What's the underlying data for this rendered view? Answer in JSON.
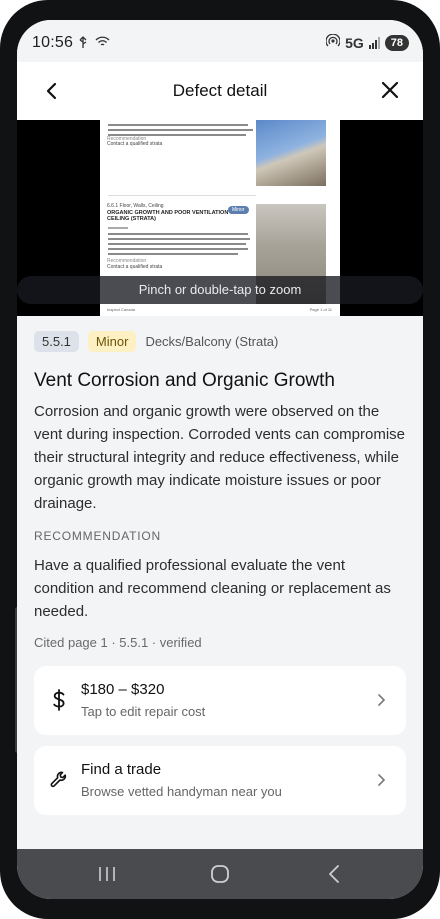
{
  "status_bar": {
    "time": "10:56",
    "network": "5G",
    "battery": "78",
    "left_icons": [
      "usb-icon",
      "wifi-icon"
    ],
    "right_icons": [
      "hotspot-icon",
      "signal-icon"
    ]
  },
  "header": {
    "title": "Defect detail",
    "back_icon": "chevron-left-icon",
    "close_icon": "close-icon"
  },
  "preview": {
    "zoom_hint": "Pinch or double-tap to zoom",
    "page_lines": {
      "rec1": "Recommendation",
      "contact1": "Contact a qualified strata",
      "section": "6.6.1 Floor, Walls, Ceiling",
      "heading1": "ORGANIC GROWTH AND POOR VENTILATION ON",
      "heading2": "CEILING (STRATA)",
      "severity": "Minor",
      "rec2": "Recommendation",
      "contact2": "Contact a qualified strata",
      "footer_left": "Inspect Canada",
      "footer_right": "Page 1 of 11"
    }
  },
  "defect": {
    "number": "5.5.1",
    "severity": "Minor",
    "location": "Decks/Balcony (Strata)",
    "title": "Vent Corrosion and Organic Growth",
    "description": "Corrosion and organic growth were observed on the vent during inspection. Corroded vents can compromise their structural integrity and reduce effectiveness, while organic growth may indicate moisture issues or poor drainage.",
    "recommendation_label": "RECOMMENDATION",
    "recommendation": "Have a qualified professional evaluate the vent condition and recommend cleaning or replacement as needed.",
    "cited": "Cited page 1 · 5.5.1 · verified"
  },
  "cards": {
    "cost": {
      "title": "$180 – $320",
      "subtitle": "Tap to edit repair cost",
      "icon": "dollar-icon"
    },
    "trade": {
      "title": "Find a trade",
      "subtitle": "Browse vetted handyman near you",
      "icon": "wrench-icon"
    }
  },
  "nav": {
    "recents_icon": "recents-icon",
    "home_icon": "home-icon",
    "back_icon": "back-icon"
  },
  "colors": {
    "background": "#f3f4f6",
    "severity_minor_bg": "#fdf0c2",
    "chip_bg": "#dde2ea",
    "navbar": "#4a4b4e"
  }
}
